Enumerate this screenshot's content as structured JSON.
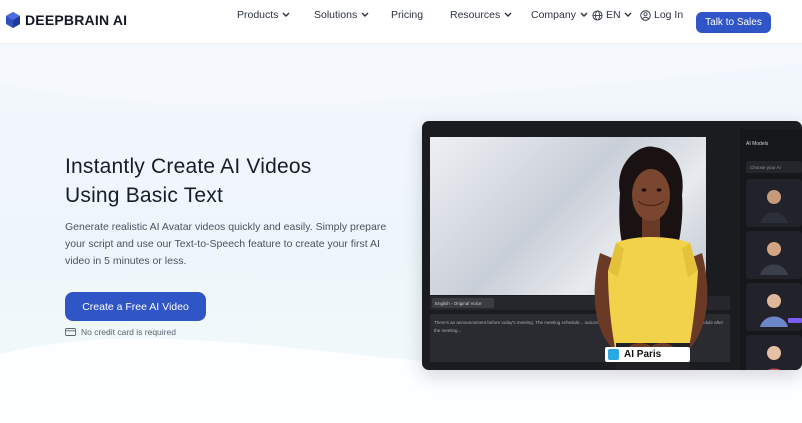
{
  "nav": {
    "brand": "DEEPBRAIN AI",
    "items": [
      {
        "label": "Products",
        "has_chevron": true
      },
      {
        "label": "Solutions",
        "has_chevron": true
      },
      {
        "label": "Pricing",
        "has_chevron": false
      },
      {
        "label": "Resources",
        "has_chevron": true
      },
      {
        "label": "Company",
        "has_chevron": true
      }
    ],
    "language": "EN",
    "login": "Log In",
    "cta": "Talk to Sales"
  },
  "hero": {
    "title_line1": "Instantly Create AI Videos",
    "title_line2": "Using Basic Text",
    "subtitle": "Generate realistic AI Avatar videos quickly and easily. Simply prepare your script and use our Text-to-Speech feature to create your first AI video in 5 minutes or less.",
    "cta": "Create a Free AI Video",
    "note": "No credit card is required"
  },
  "mockup": {
    "voice_tag": "English - Original Voice",
    "script_text": "There's an announcement before today's meeting. The meeting schedule... outcome of today's meeting. Please double-check your schedule after the meeting...",
    "avatar_name": "AI Paris",
    "panel_title": "AI Models",
    "panel_search": "Choose your AI"
  },
  "colors": {
    "accent": "#2f55c6",
    "text_dark": "#161c2a",
    "mock_bg": "#1b1c20",
    "badge": "#7c5cf5"
  }
}
